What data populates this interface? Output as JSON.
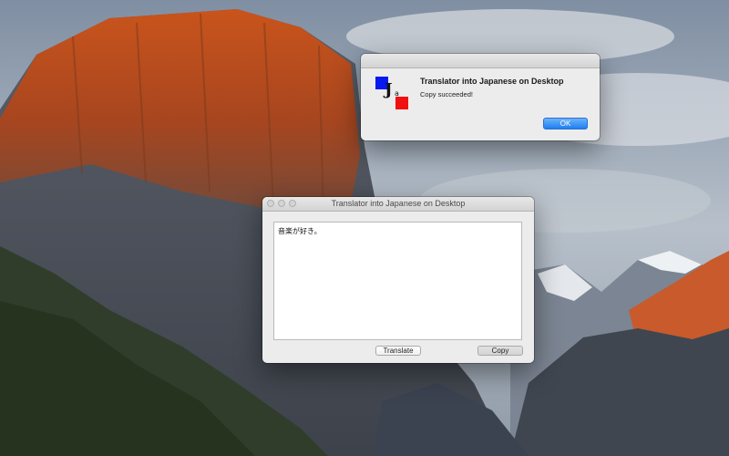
{
  "alert": {
    "title": "Translator into Japanese on Desktop",
    "message": "Copy succeeded!",
    "ok_label": "OK",
    "icon": {
      "name": "translator-app-icon",
      "letters": "J",
      "sub": "a",
      "colors": [
        "#0a18f0",
        "#f01010"
      ]
    }
  },
  "main_window": {
    "title": "Translator into Japanese on Desktop",
    "text_value": "音楽が好き。",
    "translate_label": "Translate",
    "copy_label": "Copy"
  },
  "colors": {
    "accent": "#1e7ff1",
    "window_bg": "#ececec"
  }
}
